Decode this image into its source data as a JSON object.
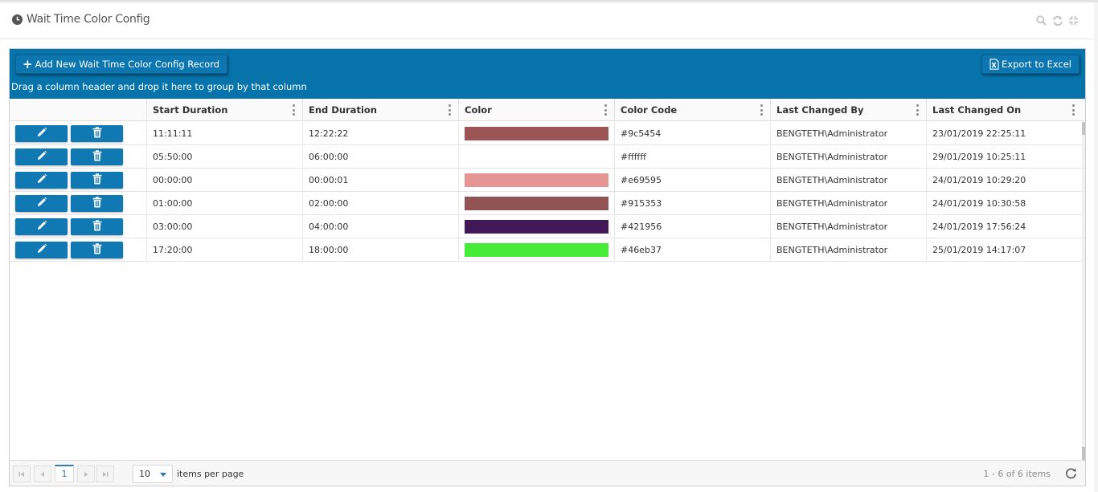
{
  "panel": {
    "title": "Wait Time Color Config"
  },
  "toolbar": {
    "add_label": "Add New Wait Time Color Config Record",
    "export_label": "Export to Excel",
    "group_hint": "Drag a column header and drop it here to group by that column"
  },
  "columns": [
    "Start Duration",
    "End Duration",
    "Color",
    "Color Code",
    "Last Changed By",
    "Last Changed On"
  ],
  "rows": [
    {
      "start": "11:11:11",
      "end": "12:22:22",
      "color": "#9c5454",
      "code": "#9c5454",
      "by": "BENGTETH\\Administrator",
      "on": "23/01/2019 22:25:11"
    },
    {
      "start": "05:50:00",
      "end": "06:00:00",
      "color": "#ffffff",
      "code": "#ffffff",
      "by": "BENGTETH\\Administrator",
      "on": "29/01/2019 10:25:11"
    },
    {
      "start": "00:00:00",
      "end": "00:00:01",
      "color": "#e69595",
      "code": "#e69595",
      "by": "BENGTETH\\Administrator",
      "on": "24/01/2019 10:29:20"
    },
    {
      "start": "01:00:00",
      "end": "02:00:00",
      "color": "#915353",
      "code": "#915353",
      "by": "BENGTETH\\Administrator",
      "on": "24/01/2019 10:30:58"
    },
    {
      "start": "03:00:00",
      "end": "04:00:00",
      "color": "#421956",
      "code": "#421956",
      "by": "BENGTETH\\Administrator",
      "on": "24/01/2019 17:56:24"
    },
    {
      "start": "17:20:00",
      "end": "18:00:00",
      "color": "#46eb37",
      "code": "#46eb37",
      "by": "BENGTETH\\Administrator",
      "on": "25/01/2019 14:17:07"
    }
  ],
  "pager": {
    "current_page": "1",
    "page_size": "10",
    "items_per_page_label": "items per page",
    "info": "1 - 6 of 6 items"
  },
  "icons": {
    "title": "clock-icon",
    "header_tools": [
      "search-icon",
      "refresh-icon",
      "compress-icon"
    ],
    "row_actions": [
      "pencil-icon",
      "trash-icon"
    ],
    "export": "excel-icon",
    "pager_refresh": "refresh-icon"
  },
  "colors": {
    "toolbar_bg": "#0773ab",
    "button_bg": "#1079b4"
  }
}
